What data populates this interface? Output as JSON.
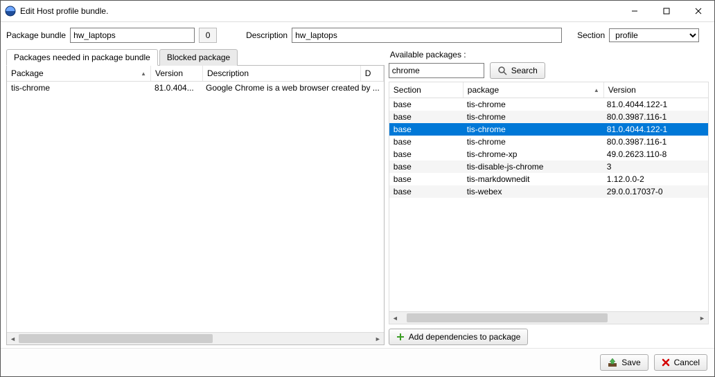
{
  "window": {
    "title": "Edit Host profile bundle."
  },
  "form": {
    "package_bundle_label": "Package bundle",
    "package_bundle_value": "hw_laptops",
    "count_value": "0",
    "description_label": "Description",
    "description_value": "hw_laptops",
    "section_label": "Section",
    "section_value": "profile"
  },
  "left": {
    "tabs": {
      "needed": "Packages needed in package bundle",
      "blocked": "Blocked package"
    },
    "columns": {
      "package": "Package",
      "version": "Version",
      "description": "Description",
      "extra": "D"
    },
    "rows": [
      {
        "package": "tis-chrome",
        "version": "81.0.404...",
        "description": "Google Chrome is a web browser created by ..."
      }
    ]
  },
  "right": {
    "available_label": "Available packages :",
    "search_value": "chrome",
    "search_button": "Search",
    "columns": {
      "section": "Section",
      "package": "package",
      "version": "Version"
    },
    "rows": [
      {
        "section": "base",
        "package": "tis-chrome",
        "version": "81.0.4044.122-1",
        "alt": false,
        "selected": false
      },
      {
        "section": "base",
        "package": "tis-chrome",
        "version": "80.0.3987.116-1",
        "alt": true,
        "selected": false
      },
      {
        "section": "base",
        "package": "tis-chrome",
        "version": "81.0.4044.122-1",
        "alt": false,
        "selected": true
      },
      {
        "section": "base",
        "package": "tis-chrome",
        "version": "80.0.3987.116-1",
        "alt": false,
        "selected": false
      },
      {
        "section": "base",
        "package": "tis-chrome-xp",
        "version": "49.0.2623.110-8",
        "alt": false,
        "selected": false
      },
      {
        "section": "base",
        "package": "tis-disable-js-chrome",
        "version": "3",
        "alt": true,
        "selected": false
      },
      {
        "section": "base",
        "package": "tis-markdownedit",
        "version": "1.12.0.0-2",
        "alt": false,
        "selected": false
      },
      {
        "section": "base",
        "package": "tis-webex",
        "version": "29.0.0.17037-0",
        "alt": true,
        "selected": false
      }
    ],
    "add_deps_button": "Add dependencies to package"
  },
  "footer": {
    "save": "Save",
    "cancel": "Cancel"
  }
}
